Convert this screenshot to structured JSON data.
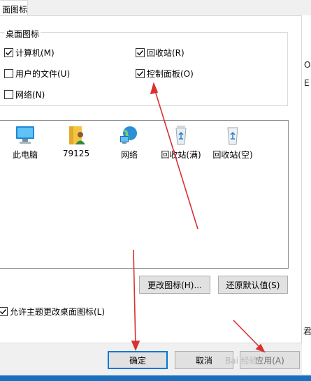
{
  "tab": {
    "label": "面图标"
  },
  "group": {
    "title": "桌面图标",
    "checkboxes": [
      {
        "label": "计算机(M)",
        "checked": true
      },
      {
        "label": "回收站(R)",
        "checked": true
      },
      {
        "label": "用户的文件(U)",
        "checked": false
      },
      {
        "label": "控制面板(O)",
        "checked": true
      },
      {
        "label": "网络(N)",
        "checked": false
      }
    ]
  },
  "icons": [
    {
      "label": "此电脑",
      "icon": "computer-icon"
    },
    {
      "label": "79125",
      "icon": "user-folder-icon"
    },
    {
      "label": "网络",
      "icon": "network-icon"
    },
    {
      "label": "回收站(满)",
      "icon": "recycle-bin-full-icon"
    },
    {
      "label": "回收站(空)",
      "icon": "recycle-bin-empty-icon"
    }
  ],
  "buttons": {
    "change_icon": "更改图标(H)...",
    "restore_default": "还原默认值(S)",
    "ok": "确定",
    "cancel": "取消",
    "apply": "应用(A)"
  },
  "allow_themes": {
    "label": "允许主题更改桌面图标(L)",
    "checked": true
  },
  "background": {
    "fragment_1": "O",
    "fragment_2": "E",
    "fragment_3": "君"
  },
  "watermark": "Bai 经验",
  "colors": {
    "focus_border": "#0078d7",
    "annotation_arrow": "#d93030"
  }
}
